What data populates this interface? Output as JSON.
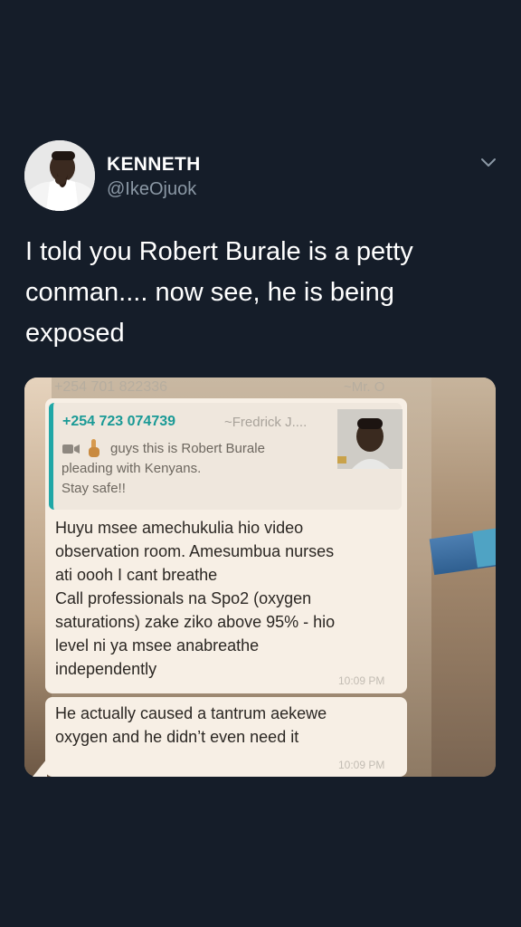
{
  "tweet": {
    "display_name": "KENNETH",
    "handle": "@IkeOjuok",
    "text": "I told you Robert Burale is a petty conman.... now see, he is being exposed"
  },
  "icons": {
    "more": "chevron-down-icon",
    "avatar": "avatar"
  },
  "screenshot": {
    "header": {
      "sender": "+254 701 822336",
      "alias": "~Mr. O"
    },
    "quoted": {
      "phone": "+254 723 074739",
      "alias": "~Fredrick J....",
      "caption_line1": "guys this is Robert Burale",
      "caption_line2": "pleading with Kenyans.",
      "caption_line3": "Stay safe!!"
    },
    "message1": {
      "line1": "Huyu msee amechukulia hio video",
      "line2": "observation room.  Amesumbua nurses",
      "line3": "ati oooh I cant breathe",
      "line4": "Call professionals na Spo2 (oxygen",
      "line5": "saturations) zake ziko above 95% - hio",
      "line6": "level ni ya msee anabreathe",
      "line7": "independently",
      "time": "10:09 PM"
    },
    "message2": {
      "line1": "He actually caused a tantrum aekewe",
      "line2": "oxygen and he didn’t even need it",
      "time": "10:09 PM"
    }
  },
  "colors": {
    "background": "#151d29",
    "text": "#ffffff",
    "secondary_text": "#8b98a5",
    "whatsapp_accent": "#20a7a6",
    "bubble": "#f7efe5"
  }
}
